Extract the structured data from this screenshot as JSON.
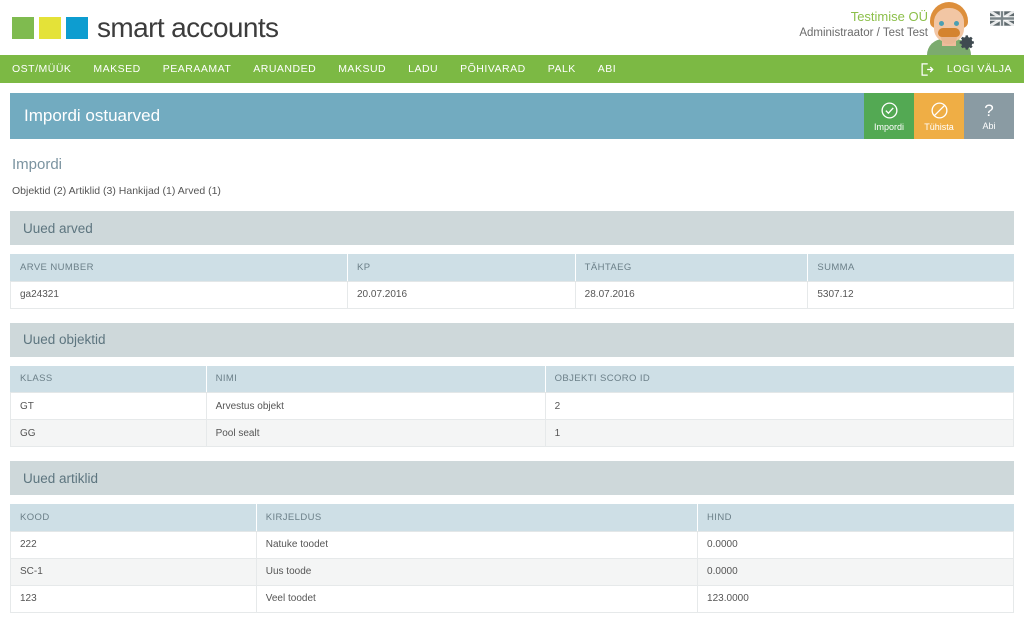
{
  "brand": {
    "name": "smart accounts",
    "square_colors": [
      "#7fbb4f",
      "#e4e238",
      "#0d9dd0"
    ]
  },
  "user": {
    "company": "Testimise OÜ",
    "role": "Administraator / Test Test",
    "avatar_icon": "user-avatar",
    "settings_icon": "gear-icon",
    "language_icon": "flag-icon"
  },
  "nav": {
    "items": [
      {
        "label": "OST/MÜÜK",
        "key": "ost-muuk"
      },
      {
        "label": "MAKSED",
        "key": "maksed"
      },
      {
        "label": "PEARAAMAT",
        "key": "pearaamat"
      },
      {
        "label": "ARUANDED",
        "key": "aruanded"
      },
      {
        "label": "MAKSUD",
        "key": "maksud"
      },
      {
        "label": "LADU",
        "key": "ladu"
      },
      {
        "label": "PÕHIVARAD",
        "key": "pohivarad"
      },
      {
        "label": "PALK",
        "key": "palk"
      },
      {
        "label": "ABI",
        "key": "abi"
      }
    ],
    "logout_label": "LOGI VÄLJA",
    "logout_icon": "logout-icon",
    "background": "#7cb944"
  },
  "page_header": {
    "title": "Impordi ostuarved",
    "background": "#72abc0",
    "actions": [
      {
        "label": "Impordi",
        "icon": "check-circle-icon",
        "color": "#53a953"
      },
      {
        "label": "Tühista",
        "icon": "ban-circle-icon",
        "color": "#efae45"
      },
      {
        "label": "Abi",
        "icon": "question-mark-icon",
        "color": "#8a9ba3"
      }
    ]
  },
  "main": {
    "section_title": "Impordi",
    "summary": "Objektid (2) Artiklid (3) Hankijad (1) Arved (1)",
    "groups": [
      {
        "title": "Uued arved",
        "columns": [
          "ARVE NUMBER",
          "KP",
          "TÄHTAEG",
          "SUMMA"
        ],
        "widths": [
          "33.6%",
          "22.7%",
          "23.2%",
          "20.5%"
        ],
        "rows": [
          [
            "ga24321",
            "20.07.2016",
            "28.07.2016",
            "5307.12"
          ]
        ]
      },
      {
        "title": "Uued objektid",
        "columns": [
          "KLASS",
          "NIMI",
          "OBJEKTI SCORO ID"
        ],
        "widths": [
          "19.5%",
          "33.8%",
          "46.7%"
        ],
        "rows": [
          [
            "GT",
            "Arvestus objekt",
            "2"
          ],
          [
            "GG",
            "Pool sealt",
            "1"
          ]
        ]
      },
      {
        "title": "Uued artiklid",
        "columns": [
          "KOOD",
          "KIRJELDUS",
          "HIND"
        ],
        "widths": [
          "24.5%",
          "44.0%",
          "31.5%"
        ],
        "rows": [
          [
            "222",
            "Natuke toodet",
            "0.0000"
          ],
          [
            "SC-1",
            "Uus toode",
            "0.0000"
          ],
          [
            "123",
            "Veel toodet",
            "123.0000"
          ]
        ]
      }
    ]
  }
}
